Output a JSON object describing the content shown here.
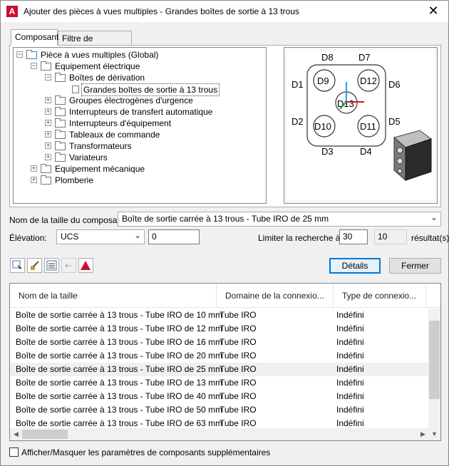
{
  "window": {
    "title": "Ajouter des pièces à vues multiples - Grandes boîtes de sortie à 13 trous",
    "app_icon": "A"
  },
  "tabs": [
    {
      "label": "Composant"
    },
    {
      "label": "Filtre de composant"
    }
  ],
  "tree": {
    "items": [
      {
        "label": "Pièce à vues multiples (Global)"
      },
      {
        "label": "Equipement électrique"
      },
      {
        "label": "Boîtes de dérivation"
      },
      {
        "label": "Grandes boîtes de sortie à 13 trous"
      },
      {
        "label": "Groupes électrogènes d'urgence"
      },
      {
        "label": "Interrupteurs de transfert automatique"
      },
      {
        "label": "Interrupteurs d'équipement"
      },
      {
        "label": "Tableaux de commande"
      },
      {
        "label": "Transformateurs"
      },
      {
        "label": "Variateurs"
      },
      {
        "label": "Equipement mécanique"
      },
      {
        "label": "Plomberie"
      }
    ]
  },
  "preview": {
    "connectors": [
      "D8",
      "D7",
      "D1",
      "D6",
      "D9",
      "D12",
      "D13",
      "D2",
      "D5",
      "D10",
      "D11",
      "D3",
      "D4"
    ]
  },
  "form": {
    "size_label": "Nom de la taille du composant:",
    "size_value": "Boîte de sortie carrée à 13 trous - Tube IRO de 25 mm",
    "elevation_label": "Élévation:",
    "elevation_combo": "UCS",
    "elevation_value": "0",
    "limit_label": "Limiter la recherche à:",
    "limit_value": "30",
    "result_count": "10",
    "results_suffix": "résultat(s)"
  },
  "buttons": {
    "details": "Détails",
    "close": "Fermer"
  },
  "grid": {
    "columns": [
      "Nom de la taille",
      "Domaine de la connexio...",
      "Type de connexio..."
    ],
    "rows": [
      {
        "name": "Boîte de sortie carrée à 13 trous - Tube IRO de 10 mm",
        "domain": "Tube IRO",
        "type": "Indéfini"
      },
      {
        "name": "Boîte de sortie carrée à 13 trous - Tube IRO de 12 mm",
        "domain": "Tube IRO",
        "type": "Indéfini"
      },
      {
        "name": "Boîte de sortie carrée à 13 trous - Tube IRO de 16 mm",
        "domain": "Tube IRO",
        "type": "Indéfini"
      },
      {
        "name": "Boîte de sortie carrée à 13 trous - Tube IRO de 20 mm",
        "domain": "Tube IRO",
        "type": "Indéfini"
      },
      {
        "name": "Boîte de sortie carrée à 13 trous - Tube IRO de 25 mm",
        "domain": "Tube IRO",
        "type": "Indéfini"
      },
      {
        "name": "Boîte de sortie carrée à 13 trous - Tube IRO de 13 mm",
        "domain": "Tube IRO",
        "type": "Indéfini"
      },
      {
        "name": "Boîte de sortie carrée à 13 trous - Tube IRO de 40 mm",
        "domain": "Tube IRO",
        "type": "Indéfini"
      },
      {
        "name": "Boîte de sortie carrée à 13 trous - Tube IRO de 50 mm",
        "domain": "Tube IRO",
        "type": "Indéfini"
      },
      {
        "name": "Boîte de sortie carrée à 13 trous - Tube IRO de 63 mm",
        "domain": "Tube IRO",
        "type": "Indéfini"
      }
    ]
  },
  "footer": {
    "checkbox_label": "Afficher/Masquer les paramètres de composants supplémentaires"
  },
  "colors": {
    "accent": "#0078d7",
    "app_red": "#c8102e",
    "selection_row": "#f0f0f0"
  }
}
